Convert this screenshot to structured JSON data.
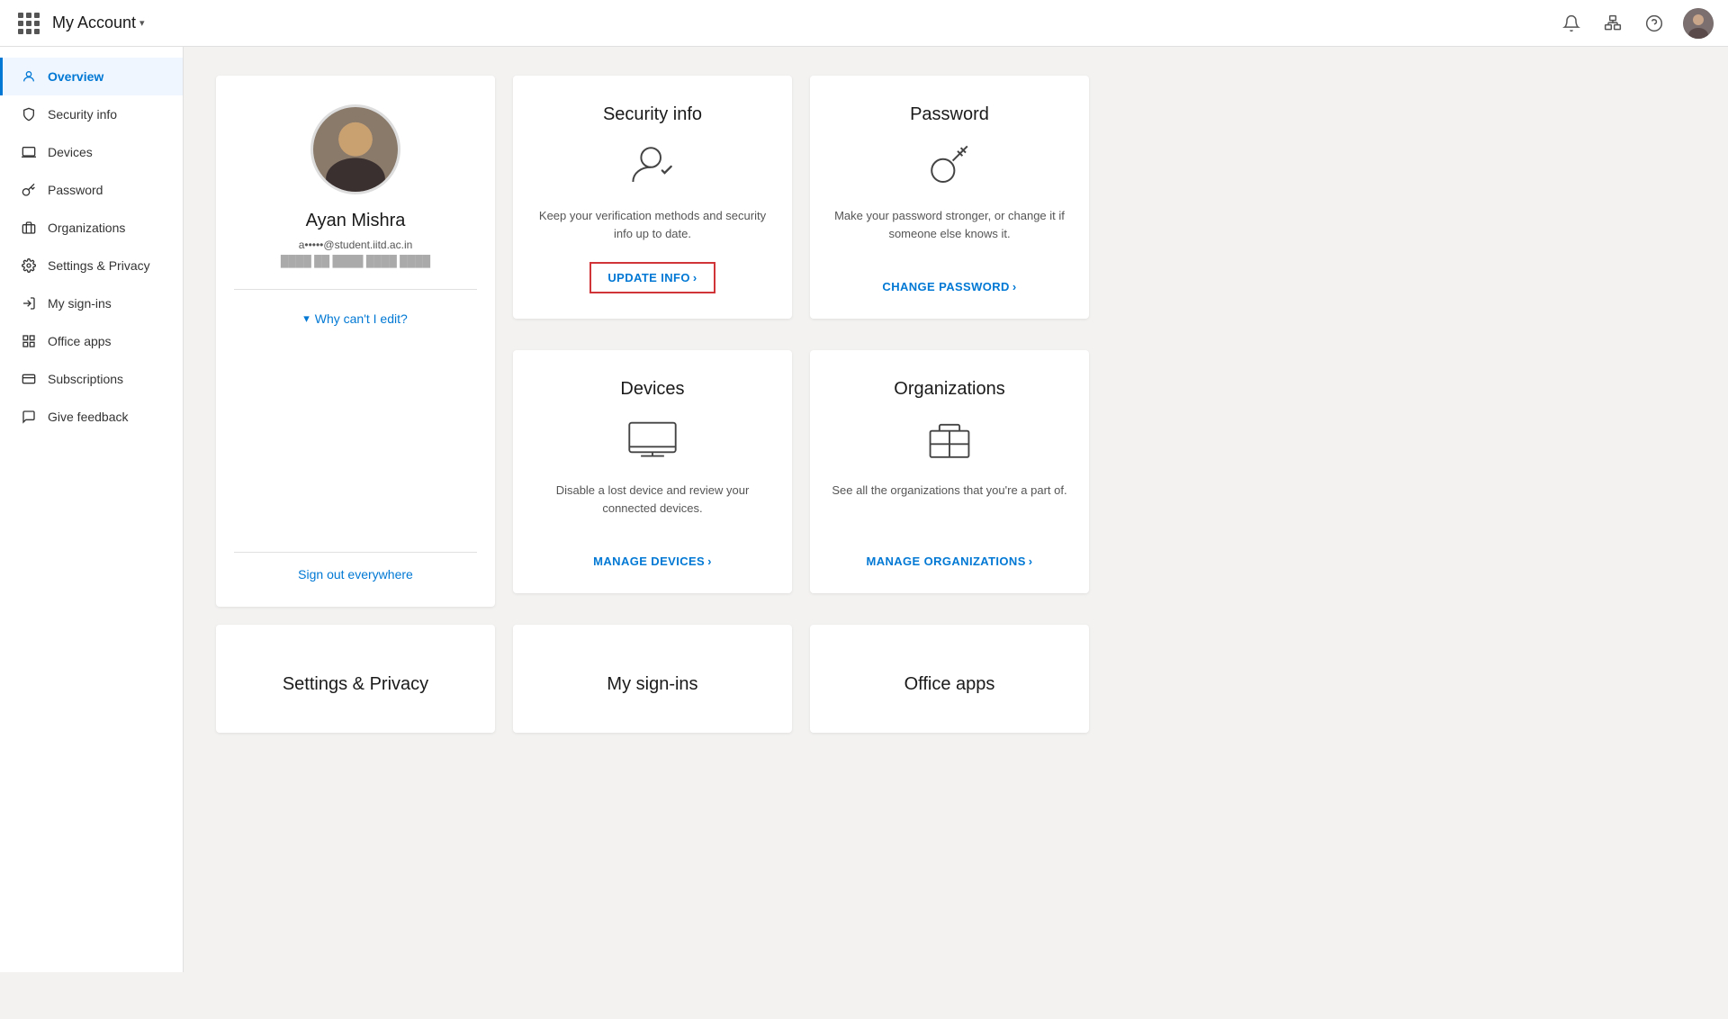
{
  "topNav": {
    "appTitle": "My Account",
    "chevron": "▾",
    "icons": {
      "search": "🔍",
      "org": "🏢",
      "help": "?"
    }
  },
  "sidebar": {
    "items": [
      {
        "id": "overview",
        "label": "Overview",
        "icon": "person",
        "active": true
      },
      {
        "id": "security-info",
        "label": "Security info",
        "icon": "shield"
      },
      {
        "id": "devices",
        "label": "Devices",
        "icon": "laptop"
      },
      {
        "id": "password",
        "label": "Password",
        "icon": "key"
      },
      {
        "id": "organizations",
        "label": "Organizations",
        "icon": "org"
      },
      {
        "id": "settings-privacy",
        "label": "Settings & Privacy",
        "icon": "gear"
      },
      {
        "id": "my-sign-ins",
        "label": "My sign-ins",
        "icon": "signin"
      },
      {
        "id": "office-apps",
        "label": "Office apps",
        "icon": "office"
      },
      {
        "id": "subscriptions",
        "label": "Subscriptions",
        "icon": "sub"
      },
      {
        "id": "give-feedback",
        "label": "Give feedback",
        "icon": "feedback"
      }
    ]
  },
  "profile": {
    "name": "Ayan Mishra",
    "email": "a•••••@student.iitd.ac.in",
    "org": "F• • • •  •• • •   • • • •",
    "whyCantEdit": "Why can't I edit?",
    "signOutEverywhere": "Sign out everywhere"
  },
  "cards": {
    "securityInfo": {
      "title": "Security info",
      "description": "Keep your verification methods and security info up to date.",
      "actionLabel": "UPDATE INFO",
      "actionArrow": "›"
    },
    "password": {
      "title": "Password",
      "description": "Make your password stronger, or change it if someone else knows it.",
      "actionLabel": "CHANGE PASSWORD",
      "actionArrow": "›"
    },
    "devices": {
      "title": "Devices",
      "description": "Disable a lost device and review your connected devices.",
      "actionLabel": "MANAGE DEVICES",
      "actionArrow": "›"
    },
    "organizations": {
      "title": "Organizations",
      "description": "See all the organizations that you're a part of.",
      "actionLabel": "MANAGE ORGANIZATIONS",
      "actionArrow": "›"
    },
    "settingsPrivacy": {
      "title": "Settings & Privacy"
    },
    "mySignIns": {
      "title": "My sign-ins"
    },
    "officeApps": {
      "title": "Office apps"
    }
  }
}
